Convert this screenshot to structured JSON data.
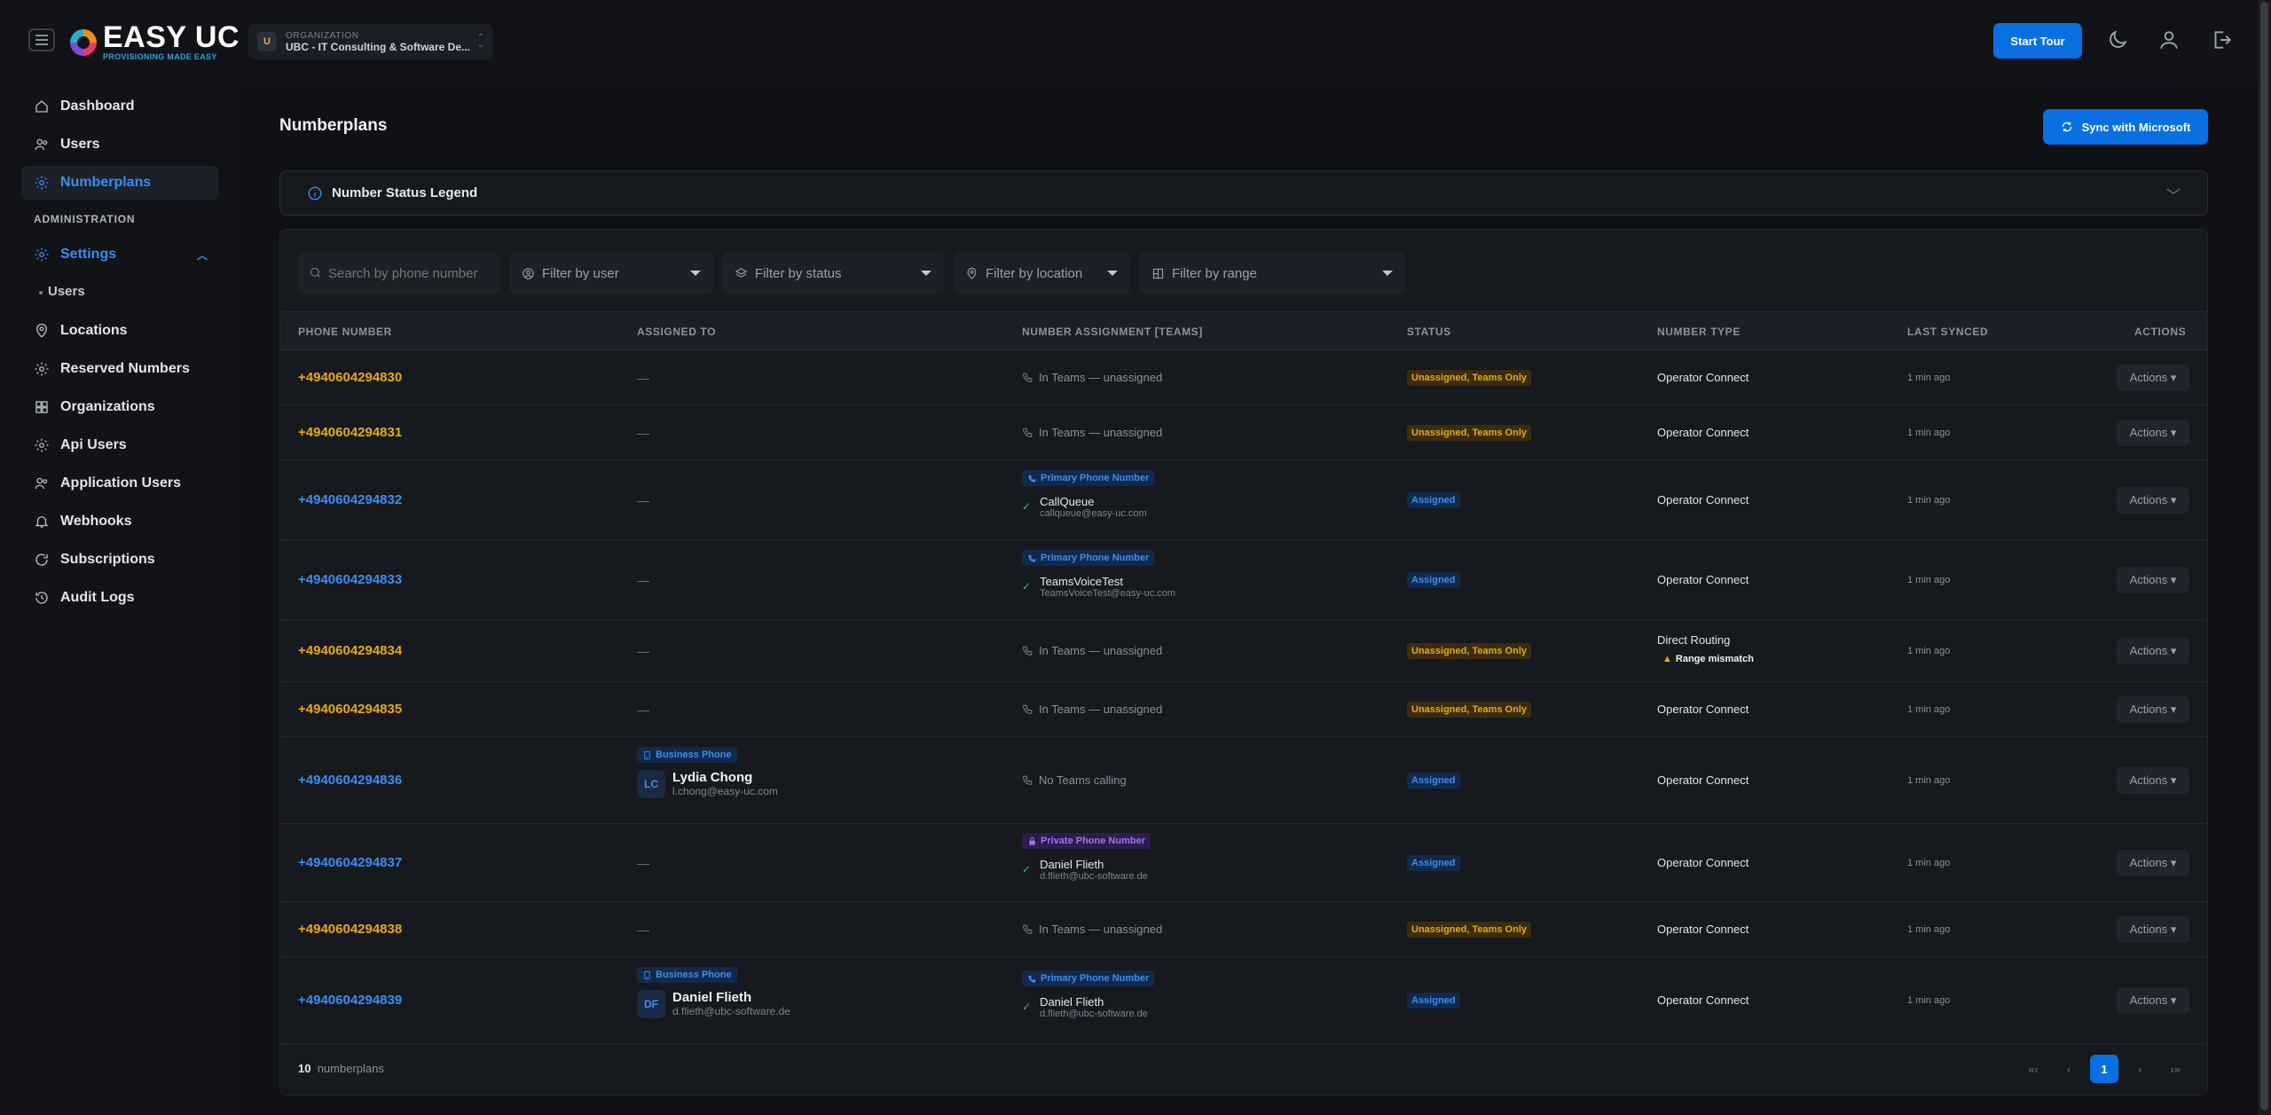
{
  "app": {
    "logo_title": "EASY UC",
    "logo_subtitle": "PROVISIONING MADE EASY",
    "org_label": "ORGANIZATION",
    "org_avatar": "U",
    "org_name": "UBC - IT Consulting & Software De...",
    "start_tour": "Start Tour",
    "icons": [
      "menu-icon",
      "moon-icon",
      "user-icon",
      "logout-icon"
    ]
  },
  "sidebar": {
    "items": [
      {
        "label": "Dashboard",
        "icon": "home-icon"
      },
      {
        "label": "Users",
        "icon": "users-icon"
      },
      {
        "label": "Numberplans",
        "icon": "numberplans-icon",
        "active": true
      }
    ],
    "admin_section": "ADMINISTRATION",
    "settings": {
      "label": "Settings",
      "sub": "Users"
    },
    "admin_items": [
      {
        "label": "Locations",
        "icon": "location-icon"
      },
      {
        "label": "Reserved Numbers",
        "icon": "gear-icon"
      },
      {
        "label": "Organizations",
        "icon": "grid-icon"
      },
      {
        "label": "Api Users",
        "icon": "gear-icon"
      },
      {
        "label": "Application Users",
        "icon": "users-icon"
      },
      {
        "label": "Webhooks",
        "icon": "bell-icon"
      },
      {
        "label": "Subscriptions",
        "icon": "refresh-icon"
      },
      {
        "label": "Audit Logs",
        "icon": "history-icon"
      }
    ]
  },
  "main": {
    "title": "Numberplans",
    "sync_button": "Sync with Microsoft",
    "legend_title": "Number Status Legend",
    "filters": {
      "search_placeholder": "Search by phone number",
      "user": "Filter by user",
      "status": "Filter by status",
      "location": "Filter by location",
      "range": "Filter by range"
    },
    "columns": [
      "PHONE NUMBER",
      "ASSIGNED TO",
      "NUMBER ASSIGNMENT [TEAMS]",
      "STATUS",
      "NUMBER TYPE",
      "LAST SYNCED",
      "ACTIONS"
    ],
    "actions_label": "Actions ▾",
    "rows": [
      {
        "phone": "+4940604294830",
        "color": "amber",
        "assigned": "—",
        "teams_line": "In Teams — unassigned",
        "status": "Unassigned, Teams Only",
        "status_color": "amber",
        "type": "Operator Connect",
        "synced": "1 min ago"
      },
      {
        "phone": "+4940604294831",
        "color": "amber",
        "assigned": "—",
        "teams_line": "In Teams — unassigned",
        "status": "Unassigned, Teams Only",
        "status_color": "amber",
        "type": "Operator Connect",
        "synced": "1 min ago"
      },
      {
        "phone": "+4940604294832",
        "color": "blue",
        "assigned": "—",
        "teams_tag": "Primary Phone Number",
        "teams_name": "CallQueue",
        "teams_mail": "callqueue@easy-uc.com",
        "status": "Assigned",
        "status_color": "blue",
        "type": "Operator Connect",
        "synced": "1 min ago"
      },
      {
        "phone": "+4940604294833",
        "color": "blue",
        "assigned": "—",
        "teams_tag": "Primary Phone Number",
        "teams_name": "TeamsVoiceTest",
        "teams_mail": "TeamsVoiceTest@easy-uc.com",
        "status": "Assigned",
        "status_color": "blue",
        "type": "Operator Connect",
        "synced": "1 min ago"
      },
      {
        "phone": "+4940604294834",
        "color": "amber",
        "assigned": "—",
        "teams_line": "In Teams — unassigned",
        "status": "Unassigned, Teams Only",
        "status_color": "amber",
        "type": "Direct Routing",
        "warning": "Range mismatch",
        "synced": "1 min ago"
      },
      {
        "phone": "+4940604294835",
        "color": "amber",
        "assigned": "—",
        "teams_line": "In Teams — unassigned",
        "status": "Unassigned, Teams Only",
        "status_color": "amber",
        "type": "Operator Connect",
        "synced": "1 min ago"
      },
      {
        "phone": "+4940604294836",
        "color": "blue",
        "assigned_tag": "Business Phone",
        "assigned_initials": "LC",
        "assigned_name": "Lydia Chong",
        "assigned_mail": "l.chong@easy-uc.com",
        "teams_line": "No Teams calling",
        "status": "Assigned",
        "status_color": "blue",
        "type": "Operator Connect",
        "synced": "1 min ago"
      },
      {
        "phone": "+4940604294837",
        "color": "blue",
        "assigned": "—",
        "teams_tag": "Private Phone Number",
        "teams_tag_color": "purple",
        "teams_name": "Daniel Flieth",
        "teams_mail": "d.flieth@ubc-software.de",
        "status": "Assigned",
        "status_color": "blue",
        "type": "Operator Connect",
        "synced": "1 min ago"
      },
      {
        "phone": "+4940604294838",
        "color": "amber",
        "assigned": "—",
        "teams_line": "In Teams — unassigned",
        "status": "Unassigned, Teams Only",
        "status_color": "amber",
        "type": "Operator Connect",
        "synced": "1 min ago"
      },
      {
        "phone": "+4940604294839",
        "color": "blue",
        "assigned_tag": "Business Phone",
        "assigned_initials": "DF",
        "assigned_name": "Daniel Flieth",
        "assigned_mail": "d.flieth@ubc-software.de",
        "teams_tag": "Primary Phone Number",
        "teams_name": "Daniel Flieth",
        "teams_mail": "d.flieth@ubc-software.de",
        "status": "Assigned",
        "status_color": "blue",
        "type": "Operator Connect",
        "synced": "1 min ago"
      }
    ],
    "footer_count": "10",
    "footer_label": "numberplans",
    "pager": {
      "first": "«‹",
      "prev": "‹",
      "page": "1",
      "next": "›",
      "last": "›»"
    }
  },
  "colors": {
    "accent": "#0a6fe0",
    "amber": "#e7a91a",
    "blue": "#3b8df0",
    "bg": "#0f1115"
  }
}
